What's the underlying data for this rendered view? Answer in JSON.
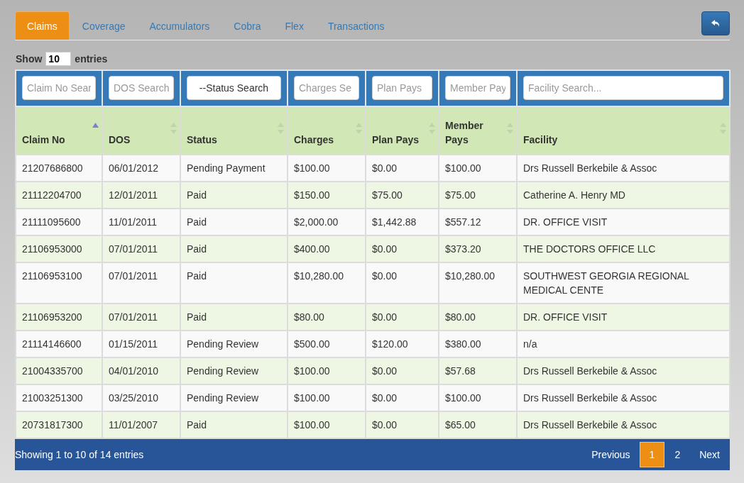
{
  "tabs": [
    {
      "label": "Claims",
      "selected": true
    },
    {
      "label": "Coverage",
      "selected": false
    },
    {
      "label": "Accumulators",
      "selected": false
    },
    {
      "label": "Cobra",
      "selected": false
    },
    {
      "label": "Flex",
      "selected": false
    },
    {
      "label": "Transactions",
      "selected": false
    }
  ],
  "length_menu": {
    "before": "Show",
    "value": "10",
    "after": "entries"
  },
  "filters": [
    {
      "kind": "input",
      "placeholder": "Claim No Sear"
    },
    {
      "kind": "input",
      "placeholder": "DOS Search"
    },
    {
      "kind": "select",
      "value": "--Status Search"
    },
    {
      "kind": "input",
      "placeholder": "Charges Se"
    },
    {
      "kind": "input",
      "placeholder": "Plan Pays"
    },
    {
      "kind": "input",
      "placeholder": "Member Pay"
    },
    {
      "kind": "input",
      "placeholder": "Facility Search..."
    }
  ],
  "columns": [
    {
      "label": "Claim No",
      "sorted": true
    },
    {
      "label": "DOS",
      "sorted": false
    },
    {
      "label": "Status",
      "sorted": false
    },
    {
      "label": "Charges",
      "sorted": false
    },
    {
      "label": "Plan Pays",
      "sorted": false
    },
    {
      "label": "Member Pays",
      "sorted": false
    },
    {
      "label": "Facility",
      "sorted": false
    }
  ],
  "rows": [
    [
      "21207686800",
      "06/01/2012",
      "Pending Payment",
      "$100.00",
      "$0.00",
      "$100.00",
      "Drs Russell Berkebile & Assoc"
    ],
    [
      "21112204700",
      "12/01/2011",
      "Paid",
      "$150.00",
      "$75.00",
      "$75.00",
      "Catherine A. Henry MD"
    ],
    [
      "21111095600",
      "11/01/2011",
      "Paid",
      "$2,000.00",
      "$1,442.88",
      "$557.12",
      "DR. OFFICE VISIT"
    ],
    [
      "21106953000",
      "07/01/2011",
      "Paid",
      "$400.00",
      "$0.00",
      "$373.20",
      "THE DOCTORS OFFICE LLC"
    ],
    [
      "21106953100",
      "07/01/2011",
      "Paid",
      "$10,280.00",
      "$0.00",
      "$10,280.00",
      "SOUTHWEST GEORGIA REGIONAL MEDICAL CENTE"
    ],
    [
      "21106953200",
      "07/01/2011",
      "Paid",
      "$80.00",
      "$0.00",
      "$80.00",
      "DR. OFFICE VISIT"
    ],
    [
      "21114146600",
      "01/15/2011",
      "Pending Review",
      "$500.00",
      "$120.00",
      "$380.00",
      "n/a"
    ],
    [
      "21004335700",
      "04/01/2010",
      "Pending Review",
      "$100.00",
      "$0.00",
      "$57.68",
      "Drs Russell Berkebile & Assoc"
    ],
    [
      "21003251300",
      "03/25/2010",
      "Pending Review",
      "$100.00",
      "$0.00",
      "$100.00",
      "Drs Russell Berkebile & Assoc"
    ],
    [
      "20731817300",
      "11/01/2007",
      "Paid",
      "$100.00",
      "$0.00",
      "$65.00",
      "Drs Russell Berkebile & Assoc"
    ]
  ],
  "info": "Showing 1 to 10 of 14 entries",
  "pagination": [
    {
      "label": "Previous",
      "kind": "nav",
      "selected": false
    },
    {
      "label": "1",
      "kind": "page",
      "selected": true
    },
    {
      "label": "2",
      "kind": "page",
      "selected": false
    },
    {
      "label": "Next",
      "kind": "nav",
      "selected": false
    }
  ]
}
